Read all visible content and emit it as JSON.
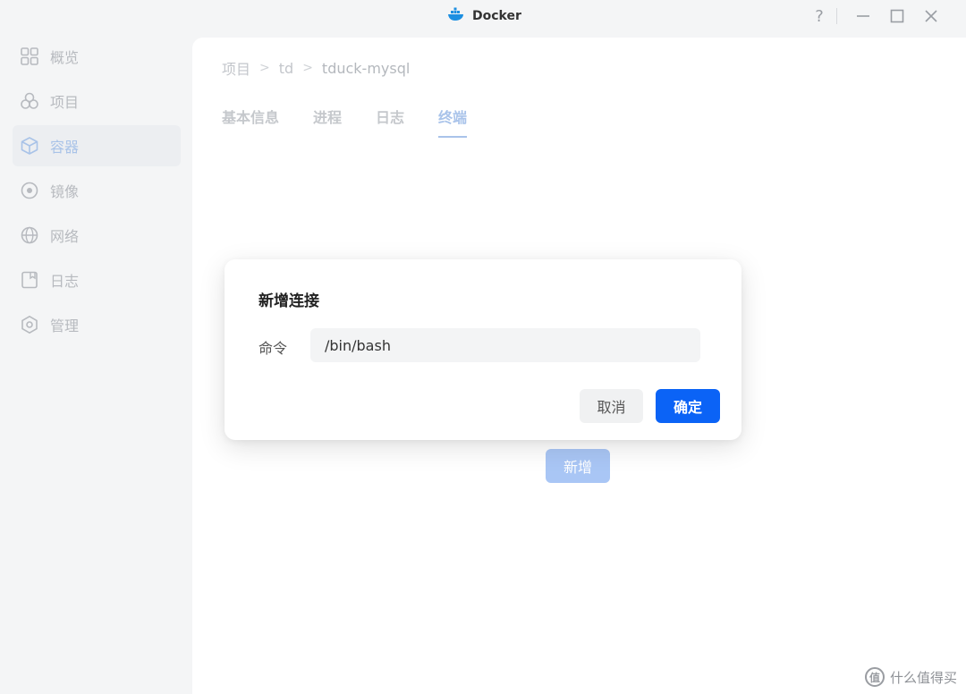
{
  "window": {
    "title": "Docker",
    "help_label": "?"
  },
  "sidebar": {
    "items": [
      {
        "label": "概览",
        "icon": "grid-icon"
      },
      {
        "label": "项目",
        "icon": "circles-icon"
      },
      {
        "label": "容器",
        "icon": "cube-icon"
      },
      {
        "label": "镜像",
        "icon": "disc-icon"
      },
      {
        "label": "网络",
        "icon": "globe-icon"
      },
      {
        "label": "日志",
        "icon": "log-icon"
      },
      {
        "label": "管理",
        "icon": "hexagon-gear-icon"
      }
    ],
    "active": "容器"
  },
  "breadcrumb": {
    "items": [
      "项目",
      "td",
      "tduck-mysql"
    ]
  },
  "tabs": [
    {
      "label": "基本信息"
    },
    {
      "label": "进程"
    },
    {
      "label": "日志"
    },
    {
      "label": "终端"
    }
  ],
  "active_tab": "终端",
  "terminal": {
    "add_label": "新增"
  },
  "modal": {
    "title": "新增连接",
    "command_label": "命令",
    "command_value": "/bin/bash",
    "cancel_label": "取消",
    "confirm_label": "确定"
  },
  "watermark": {
    "logo_text": "值",
    "text": "什么值得买"
  },
  "colors": {
    "primary": "#0b63f6",
    "active_light": "#a9c3ea"
  }
}
